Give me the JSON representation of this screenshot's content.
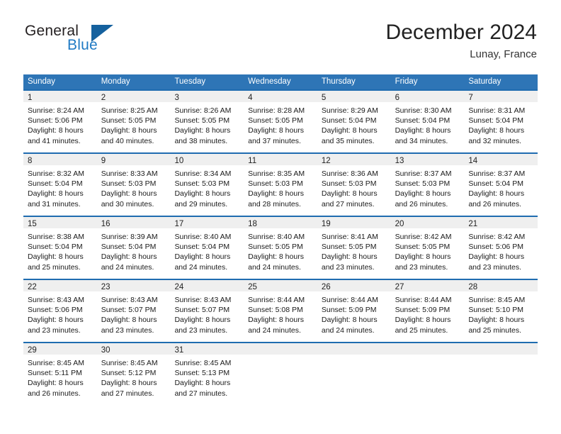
{
  "brand": {
    "name_part1": "General",
    "name_part2": "Blue",
    "triangle_color": "#15619e",
    "blue_color": "#1f7ac4"
  },
  "header": {
    "title": "December 2024",
    "subtitle": "Lunay, France"
  },
  "theme": {
    "header_band": "#2e75b6",
    "row_divider": "#1f6cb0",
    "daynum_strip": "#efefef"
  },
  "weekdays": [
    "Sunday",
    "Monday",
    "Tuesday",
    "Wednesday",
    "Thursday",
    "Friday",
    "Saturday"
  ],
  "weeks": [
    [
      {
        "day": "1",
        "sunrise": "Sunrise: 8:24 AM",
        "sunset": "Sunset: 5:06 PM",
        "daylight1": "Daylight: 8 hours",
        "daylight2": "and 41 minutes."
      },
      {
        "day": "2",
        "sunrise": "Sunrise: 8:25 AM",
        "sunset": "Sunset: 5:05 PM",
        "daylight1": "Daylight: 8 hours",
        "daylight2": "and 40 minutes."
      },
      {
        "day": "3",
        "sunrise": "Sunrise: 8:26 AM",
        "sunset": "Sunset: 5:05 PM",
        "daylight1": "Daylight: 8 hours",
        "daylight2": "and 38 minutes."
      },
      {
        "day": "4",
        "sunrise": "Sunrise: 8:28 AM",
        "sunset": "Sunset: 5:05 PM",
        "daylight1": "Daylight: 8 hours",
        "daylight2": "and 37 minutes."
      },
      {
        "day": "5",
        "sunrise": "Sunrise: 8:29 AM",
        "sunset": "Sunset: 5:04 PM",
        "daylight1": "Daylight: 8 hours",
        "daylight2": "and 35 minutes."
      },
      {
        "day": "6",
        "sunrise": "Sunrise: 8:30 AM",
        "sunset": "Sunset: 5:04 PM",
        "daylight1": "Daylight: 8 hours",
        "daylight2": "and 34 minutes."
      },
      {
        "day": "7",
        "sunrise": "Sunrise: 8:31 AM",
        "sunset": "Sunset: 5:04 PM",
        "daylight1": "Daylight: 8 hours",
        "daylight2": "and 32 minutes."
      }
    ],
    [
      {
        "day": "8",
        "sunrise": "Sunrise: 8:32 AM",
        "sunset": "Sunset: 5:04 PM",
        "daylight1": "Daylight: 8 hours",
        "daylight2": "and 31 minutes."
      },
      {
        "day": "9",
        "sunrise": "Sunrise: 8:33 AM",
        "sunset": "Sunset: 5:03 PM",
        "daylight1": "Daylight: 8 hours",
        "daylight2": "and 30 minutes."
      },
      {
        "day": "10",
        "sunrise": "Sunrise: 8:34 AM",
        "sunset": "Sunset: 5:03 PM",
        "daylight1": "Daylight: 8 hours",
        "daylight2": "and 29 minutes."
      },
      {
        "day": "11",
        "sunrise": "Sunrise: 8:35 AM",
        "sunset": "Sunset: 5:03 PM",
        "daylight1": "Daylight: 8 hours",
        "daylight2": "and 28 minutes."
      },
      {
        "day": "12",
        "sunrise": "Sunrise: 8:36 AM",
        "sunset": "Sunset: 5:03 PM",
        "daylight1": "Daylight: 8 hours",
        "daylight2": "and 27 minutes."
      },
      {
        "day": "13",
        "sunrise": "Sunrise: 8:37 AM",
        "sunset": "Sunset: 5:03 PM",
        "daylight1": "Daylight: 8 hours",
        "daylight2": "and 26 minutes."
      },
      {
        "day": "14",
        "sunrise": "Sunrise: 8:37 AM",
        "sunset": "Sunset: 5:04 PM",
        "daylight1": "Daylight: 8 hours",
        "daylight2": "and 26 minutes."
      }
    ],
    [
      {
        "day": "15",
        "sunrise": "Sunrise: 8:38 AM",
        "sunset": "Sunset: 5:04 PM",
        "daylight1": "Daylight: 8 hours",
        "daylight2": "and 25 minutes."
      },
      {
        "day": "16",
        "sunrise": "Sunrise: 8:39 AM",
        "sunset": "Sunset: 5:04 PM",
        "daylight1": "Daylight: 8 hours",
        "daylight2": "and 24 minutes."
      },
      {
        "day": "17",
        "sunrise": "Sunrise: 8:40 AM",
        "sunset": "Sunset: 5:04 PM",
        "daylight1": "Daylight: 8 hours",
        "daylight2": "and 24 minutes."
      },
      {
        "day": "18",
        "sunrise": "Sunrise: 8:40 AM",
        "sunset": "Sunset: 5:05 PM",
        "daylight1": "Daylight: 8 hours",
        "daylight2": "and 24 minutes."
      },
      {
        "day": "19",
        "sunrise": "Sunrise: 8:41 AM",
        "sunset": "Sunset: 5:05 PM",
        "daylight1": "Daylight: 8 hours",
        "daylight2": "and 23 minutes."
      },
      {
        "day": "20",
        "sunrise": "Sunrise: 8:42 AM",
        "sunset": "Sunset: 5:05 PM",
        "daylight1": "Daylight: 8 hours",
        "daylight2": "and 23 minutes."
      },
      {
        "day": "21",
        "sunrise": "Sunrise: 8:42 AM",
        "sunset": "Sunset: 5:06 PM",
        "daylight1": "Daylight: 8 hours",
        "daylight2": "and 23 minutes."
      }
    ],
    [
      {
        "day": "22",
        "sunrise": "Sunrise: 8:43 AM",
        "sunset": "Sunset: 5:06 PM",
        "daylight1": "Daylight: 8 hours",
        "daylight2": "and 23 minutes."
      },
      {
        "day": "23",
        "sunrise": "Sunrise: 8:43 AM",
        "sunset": "Sunset: 5:07 PM",
        "daylight1": "Daylight: 8 hours",
        "daylight2": "and 23 minutes."
      },
      {
        "day": "24",
        "sunrise": "Sunrise: 8:43 AM",
        "sunset": "Sunset: 5:07 PM",
        "daylight1": "Daylight: 8 hours",
        "daylight2": "and 23 minutes."
      },
      {
        "day": "25",
        "sunrise": "Sunrise: 8:44 AM",
        "sunset": "Sunset: 5:08 PM",
        "daylight1": "Daylight: 8 hours",
        "daylight2": "and 24 minutes."
      },
      {
        "day": "26",
        "sunrise": "Sunrise: 8:44 AM",
        "sunset": "Sunset: 5:09 PM",
        "daylight1": "Daylight: 8 hours",
        "daylight2": "and 24 minutes."
      },
      {
        "day": "27",
        "sunrise": "Sunrise: 8:44 AM",
        "sunset": "Sunset: 5:09 PM",
        "daylight1": "Daylight: 8 hours",
        "daylight2": "and 25 minutes."
      },
      {
        "day": "28",
        "sunrise": "Sunrise: 8:45 AM",
        "sunset": "Sunset: 5:10 PM",
        "daylight1": "Daylight: 8 hours",
        "daylight2": "and 25 minutes."
      }
    ],
    [
      {
        "day": "29",
        "sunrise": "Sunrise: 8:45 AM",
        "sunset": "Sunset: 5:11 PM",
        "daylight1": "Daylight: 8 hours",
        "daylight2": "and 26 minutes."
      },
      {
        "day": "30",
        "sunrise": "Sunrise: 8:45 AM",
        "sunset": "Sunset: 5:12 PM",
        "daylight1": "Daylight: 8 hours",
        "daylight2": "and 27 minutes."
      },
      {
        "day": "31",
        "sunrise": "Sunrise: 8:45 AM",
        "sunset": "Sunset: 5:13 PM",
        "daylight1": "Daylight: 8 hours",
        "daylight2": "and 27 minutes."
      },
      {
        "day": "",
        "sunrise": "",
        "sunset": "",
        "daylight1": "",
        "daylight2": ""
      },
      {
        "day": "",
        "sunrise": "",
        "sunset": "",
        "daylight1": "",
        "daylight2": ""
      },
      {
        "day": "",
        "sunrise": "",
        "sunset": "",
        "daylight1": "",
        "daylight2": ""
      },
      {
        "day": "",
        "sunrise": "",
        "sunset": "",
        "daylight1": "",
        "daylight2": ""
      }
    ]
  ]
}
